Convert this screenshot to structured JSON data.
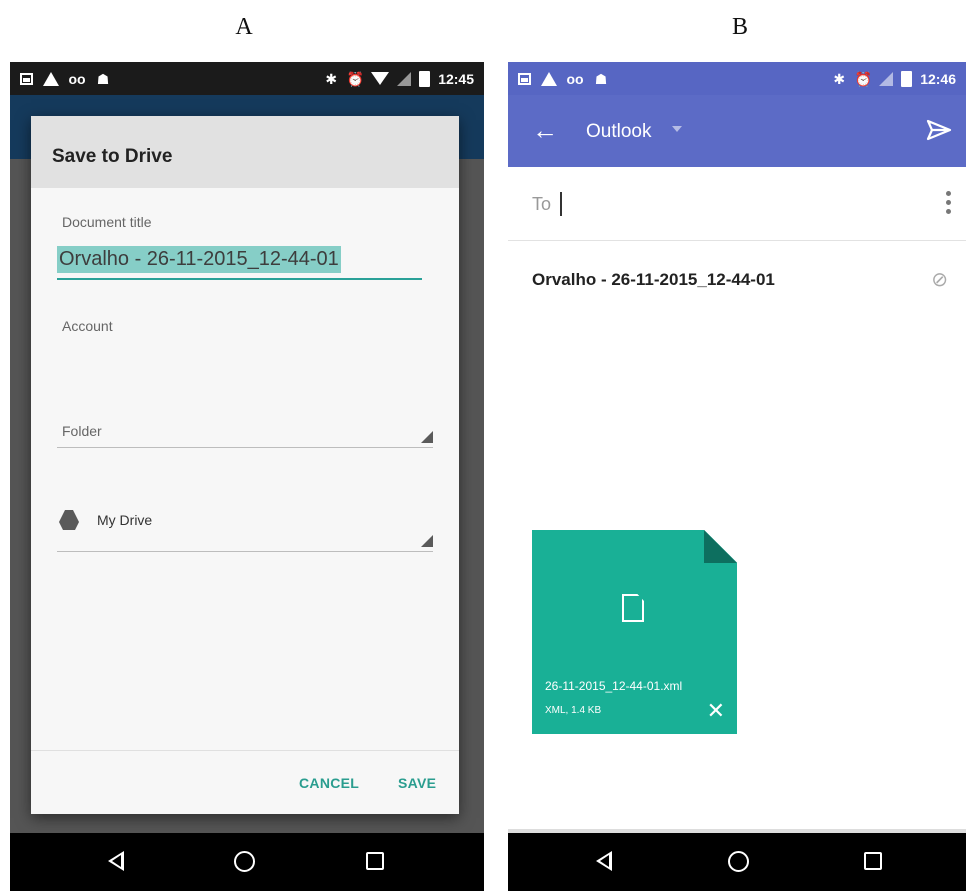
{
  "panels": {
    "a_label": "A",
    "b_label": "B"
  },
  "phone_a": {
    "status_time": "12:45",
    "dialog": {
      "title": "Save to Drive",
      "document_title_label": "Document title",
      "document_title_value": "Orvalho - 26-11-2015_12-44-01",
      "account_label": "Account",
      "account_value": "",
      "folder_label": "Folder",
      "folder_value": "My Drive",
      "cancel_label": "CANCEL",
      "save_label": "SAVE"
    }
  },
  "phone_b": {
    "status_time": "12:46",
    "app_account": "Outlook",
    "to_label": "To",
    "subject": "Orvalho - 26-11-2015_12-44-01",
    "attachment": {
      "file_name": "26-11-2015_12-44-01.xml",
      "file_meta": "XML, 1.4 KB"
    }
  },
  "colors": {
    "accent_teal": "#2a9d8f",
    "outlook_blue": "#5c6bc6",
    "attachment_green": "#19b096"
  }
}
